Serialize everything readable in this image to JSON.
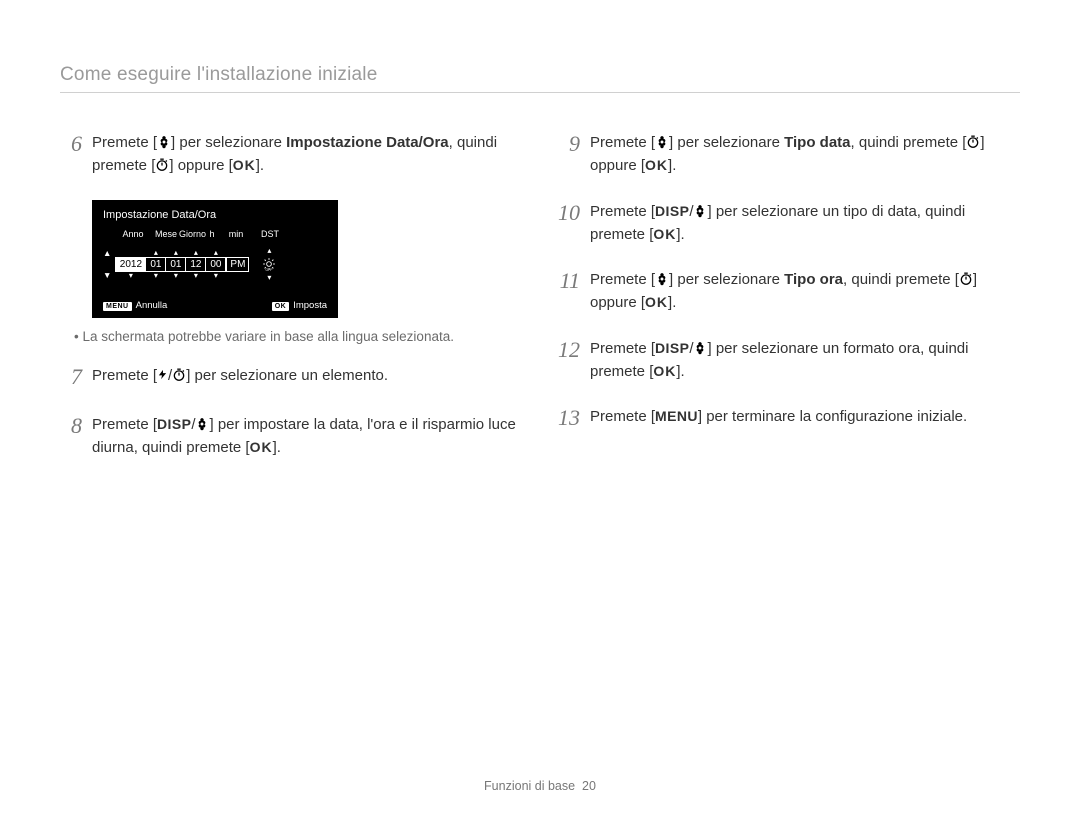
{
  "header": {
    "title": "Come eseguire l'installazione iniziale"
  },
  "icons": {
    "flower": "flower-icon",
    "timer": "timer-icon",
    "flash": "flash-icon",
    "disp": "DISP",
    "ok": "OK",
    "menu": "MENU",
    "dst_off": "dst-off-icon"
  },
  "screenshot": {
    "title": "Impostazione Data/Ora",
    "col_labels": [
      "Anno",
      "Mese",
      "Giorno",
      "h",
      "min",
      "DST"
    ],
    "values": {
      "year": "2012",
      "month": "01",
      "day": "01",
      "hour": "12",
      "minute": "00",
      "ampm": "PM"
    },
    "footer": {
      "menu_btn": "MENU",
      "cancel": "Annulla",
      "ok_btn": "OK",
      "set": "Imposta"
    }
  },
  "steps_left": [
    {
      "num": "6",
      "parts": [
        "Premete [",
        {
          "icon": "flower"
        },
        "] per selezionare ",
        {
          "bold": "Impostazione Data/Ora"
        },
        ", quindi premete [",
        {
          "icon": "timer"
        },
        "] oppure [",
        {
          "btn": "ok"
        },
        "]."
      ]
    },
    {
      "note": "La schermata potrebbe variare in base alla lingua selezionata."
    },
    {
      "num": "7",
      "parts": [
        "Premete [",
        {
          "icon": "flash"
        },
        "/",
        {
          "icon": "timer"
        },
        "] per selezionare un elemento."
      ]
    },
    {
      "num": "8",
      "parts": [
        "Premete [",
        {
          "btn": "disp"
        },
        "/",
        {
          "icon": "flower"
        },
        "] per impostare la data, l'ora e il risparmio luce diurna, quindi premete [",
        {
          "btn": "ok"
        },
        "]."
      ]
    }
  ],
  "steps_right": [
    {
      "num": "9",
      "parts": [
        "Premete [",
        {
          "icon": "flower"
        },
        "] per selezionare ",
        {
          "bold": "Tipo data"
        },
        ", quindi premete [",
        {
          "icon": "timer"
        },
        "] oppure [",
        {
          "btn": "ok"
        },
        "]."
      ]
    },
    {
      "num": "10",
      "parts": [
        "Premete [",
        {
          "btn": "disp"
        },
        "/",
        {
          "icon": "flower"
        },
        "] per selezionare un tipo di data, quindi premete [",
        {
          "btn": "ok"
        },
        "]."
      ]
    },
    {
      "num": "11",
      "parts": [
        "Premete [",
        {
          "icon": "flower"
        },
        "] per selezionare ",
        {
          "bold": "Tipo ora"
        },
        ", quindi premete [",
        {
          "icon": "timer"
        },
        "] oppure [",
        {
          "btn": "ok"
        },
        "]."
      ]
    },
    {
      "num": "12",
      "parts": [
        "Premete [",
        {
          "btn": "disp"
        },
        "/",
        {
          "icon": "flower"
        },
        "] per selezionare un formato ora, quindi premete [",
        {
          "btn": "ok"
        },
        "]."
      ]
    },
    {
      "num": "13",
      "parts": [
        "Premete [",
        {
          "btn": "menu"
        },
        "] per terminare la configurazione iniziale."
      ]
    }
  ],
  "footer": {
    "section": "Funzioni di base",
    "page": "20"
  }
}
